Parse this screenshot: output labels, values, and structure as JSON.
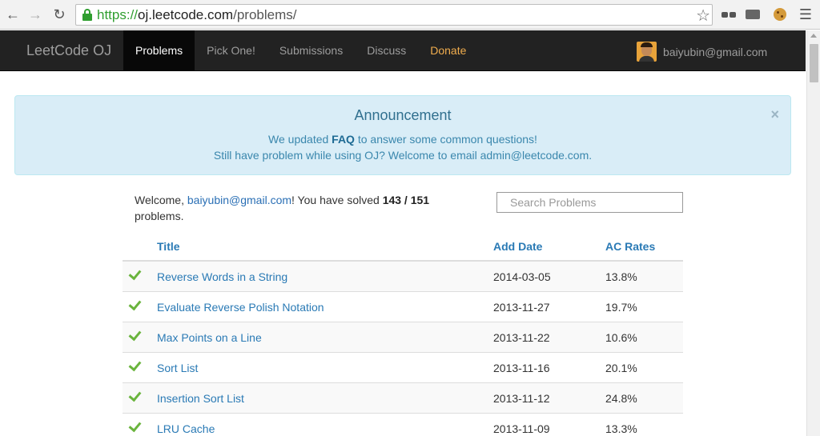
{
  "browser": {
    "url_scheme": "https://",
    "url_host": "oj.leetcode.com",
    "url_path": "/problems/"
  },
  "navbar": {
    "brand": "LeetCode OJ",
    "links": [
      {
        "label": "Problems",
        "active": true
      },
      {
        "label": "Pick One!",
        "active": false
      },
      {
        "label": "Submissions",
        "active": false
      },
      {
        "label": "Discuss",
        "active": false
      },
      {
        "label": "Donate",
        "active": false
      }
    ],
    "user_email": "baiyubin@gmail.com"
  },
  "announcement": {
    "title": "Announcement",
    "line1_pre": "We updated ",
    "line1_link": "FAQ",
    "line1_post": " to answer some common questions!",
    "line2": "Still have problem while using OJ? Welcome to email admin@leetcode.com.",
    "close": "×"
  },
  "welcome": {
    "pre": "Welcome, ",
    "email": "baiyubin@gmail.com",
    "mid": "! You have solved ",
    "solved": "143 / 151",
    "post": "problems."
  },
  "search": {
    "placeholder": "Search Problems"
  },
  "table": {
    "headers": {
      "title": "Title",
      "date": "Add Date",
      "rate": "AC Rates"
    },
    "rows": [
      {
        "title": "Reverse Words in a String",
        "date": "2014-03-05",
        "rate": "13.8%"
      },
      {
        "title": "Evaluate Reverse Polish Notation",
        "date": "2013-11-27",
        "rate": "19.7%"
      },
      {
        "title": "Max Points on a Line",
        "date": "2013-11-22",
        "rate": "10.6%"
      },
      {
        "title": "Sort List",
        "date": "2013-11-16",
        "rate": "20.1%"
      },
      {
        "title": "Insertion Sort List",
        "date": "2013-11-12",
        "rate": "24.8%"
      },
      {
        "title": "LRU Cache",
        "date": "2013-11-09",
        "rate": "13.3%"
      }
    ]
  },
  "colors": {
    "navbar_bg": "#222222",
    "donate": "#f0ad4e",
    "link": "#2a7ab5",
    "alert_bg": "#d9edf7",
    "check": "#6ab43d"
  }
}
